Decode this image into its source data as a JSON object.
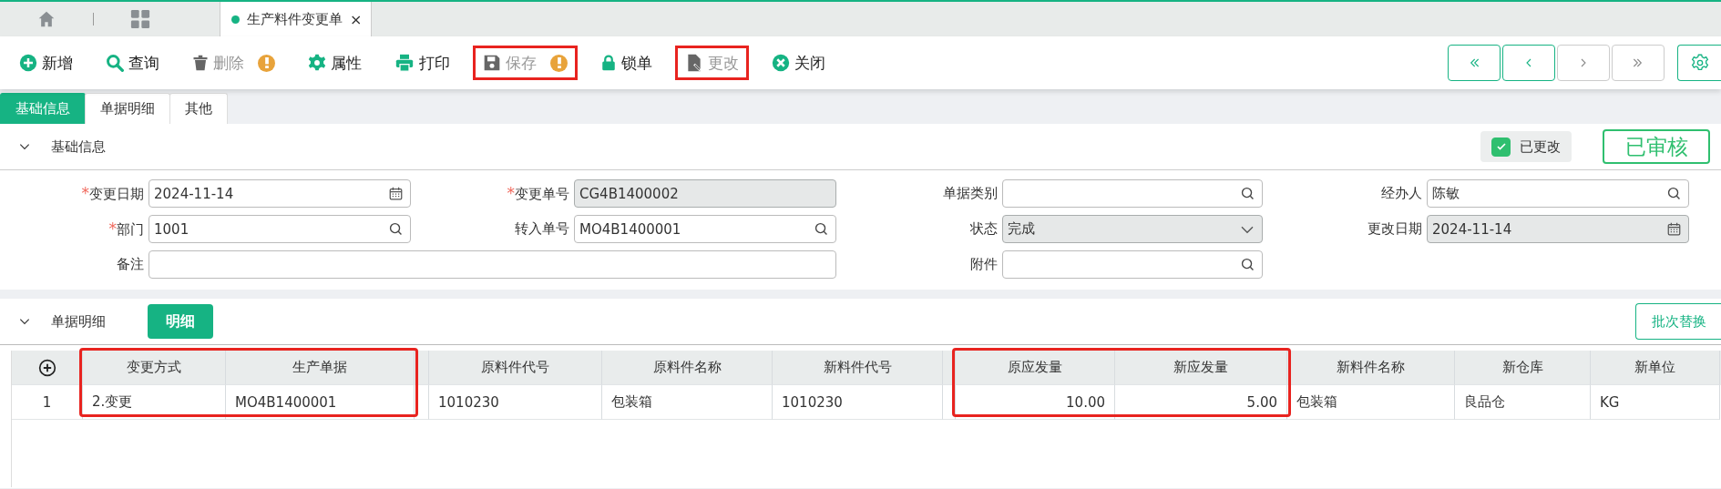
{
  "doc_tabs": [
    {
      "label": "生产料件变更单",
      "close": "×",
      "selected": true
    }
  ],
  "toolbar": [
    {
      "kind": "plus",
      "label": "新增",
      "disabled": false,
      "warning": false,
      "highlighted": false
    },
    {
      "kind": "search",
      "label": "查询",
      "disabled": false,
      "warning": false,
      "highlighted": false
    },
    {
      "kind": "trash",
      "label": "删除",
      "disabled": true,
      "warning": true,
      "highlighted": false
    },
    {
      "kind": "gear",
      "label": "属性",
      "disabled": false,
      "warning": false,
      "highlighted": false
    },
    {
      "kind": "printer",
      "label": "打印",
      "disabled": false,
      "warning": false,
      "highlighted": false
    },
    {
      "kind": "save",
      "label": "保存",
      "disabled": true,
      "warning": true,
      "highlighted": true
    },
    {
      "kind": "lock",
      "label": "锁单",
      "disabled": false,
      "warning": false,
      "highlighted": false
    },
    {
      "kind": "doc",
      "label": "更改",
      "disabled": true,
      "warning": false,
      "highlighted": true
    },
    {
      "kind": "close",
      "label": "关闭",
      "disabled": false,
      "warning": false,
      "highlighted": false
    }
  ],
  "nav_buttons": [
    {
      "kind": "first",
      "enabled": true
    },
    {
      "kind": "prev",
      "enabled": true
    },
    {
      "kind": "next",
      "enabled": false
    },
    {
      "kind": "last",
      "enabled": false
    }
  ],
  "tabs": [
    {
      "label": "基础信息",
      "selected": true
    },
    {
      "label": "单据明细",
      "selected": false
    },
    {
      "label": "其他",
      "selected": false
    }
  ],
  "basic_section": {
    "title": "基础信息",
    "expanded": true,
    "changed": {
      "label": "已更改",
      "checked": true
    },
    "status_stamp": "已审核",
    "fields": [
      {
        "required_mark": "*",
        "label": "变更日期",
        "kind": "date",
        "value": "2024-11-14",
        "readonly": false
      },
      {
        "required_mark": "*",
        "label": "变更单号",
        "kind": "text",
        "value": "CG4B1400002",
        "readonly": true
      },
      {
        "label": "单据类别",
        "kind": "lookup",
        "readonly": false
      },
      {
        "label": "经办人",
        "kind": "lookup",
        "value": "陈敏",
        "readonly": false
      },
      {
        "required_mark": "*",
        "label": "部门",
        "kind": "lookup",
        "value": "1001",
        "readonly": false
      },
      {
        "label": "转入单号",
        "kind": "lookup",
        "value": "MO4B1400001",
        "readonly": false
      },
      {
        "label": "状态",
        "kind": "select",
        "value": "完成",
        "readonly": true
      },
      {
        "label": "更改日期",
        "kind": "date",
        "value": "2024-11-14",
        "readonly": true
      },
      {
        "label": "备注",
        "kind": "text",
        "readonly": false,
        "wide": true
      },
      {
        "label": "附件",
        "kind": "lookup",
        "readonly": false
      }
    ]
  },
  "detail_section": {
    "title": "单据明细",
    "expanded": true,
    "detail_button": "明细",
    "batch_button": "批次替换",
    "columns": [
      {
        "label": "变更方式",
        "kind": "text",
        "highlighted": true
      },
      {
        "label": "生产单据",
        "kind": "text",
        "highlighted": true
      },
      {
        "label": "原料件代号",
        "kind": "text",
        "highlighted": false
      },
      {
        "label": "原料件名称",
        "kind": "text",
        "highlighted": false
      },
      {
        "label": "新料件代号",
        "kind": "text",
        "highlighted": false
      },
      {
        "label": "原应发量",
        "kind": "number",
        "highlighted": true
      },
      {
        "label": "新应发量",
        "kind": "number",
        "highlighted": true
      },
      {
        "label": "新料件名称",
        "kind": "text",
        "highlighted": false
      },
      {
        "label": "新仓库",
        "kind": "text",
        "highlighted": false
      },
      {
        "label": "新单位",
        "kind": "text",
        "highlighted": false
      }
    ],
    "rows": [
      {
        "index": "1",
        "cells": [
          "2.变更",
          "MO4B1400001",
          "1010230",
          "包装箱",
          "1010230",
          "10.00",
          "5.00",
          "包装箱",
          "良品仓",
          "KG"
        ]
      }
    ]
  }
}
